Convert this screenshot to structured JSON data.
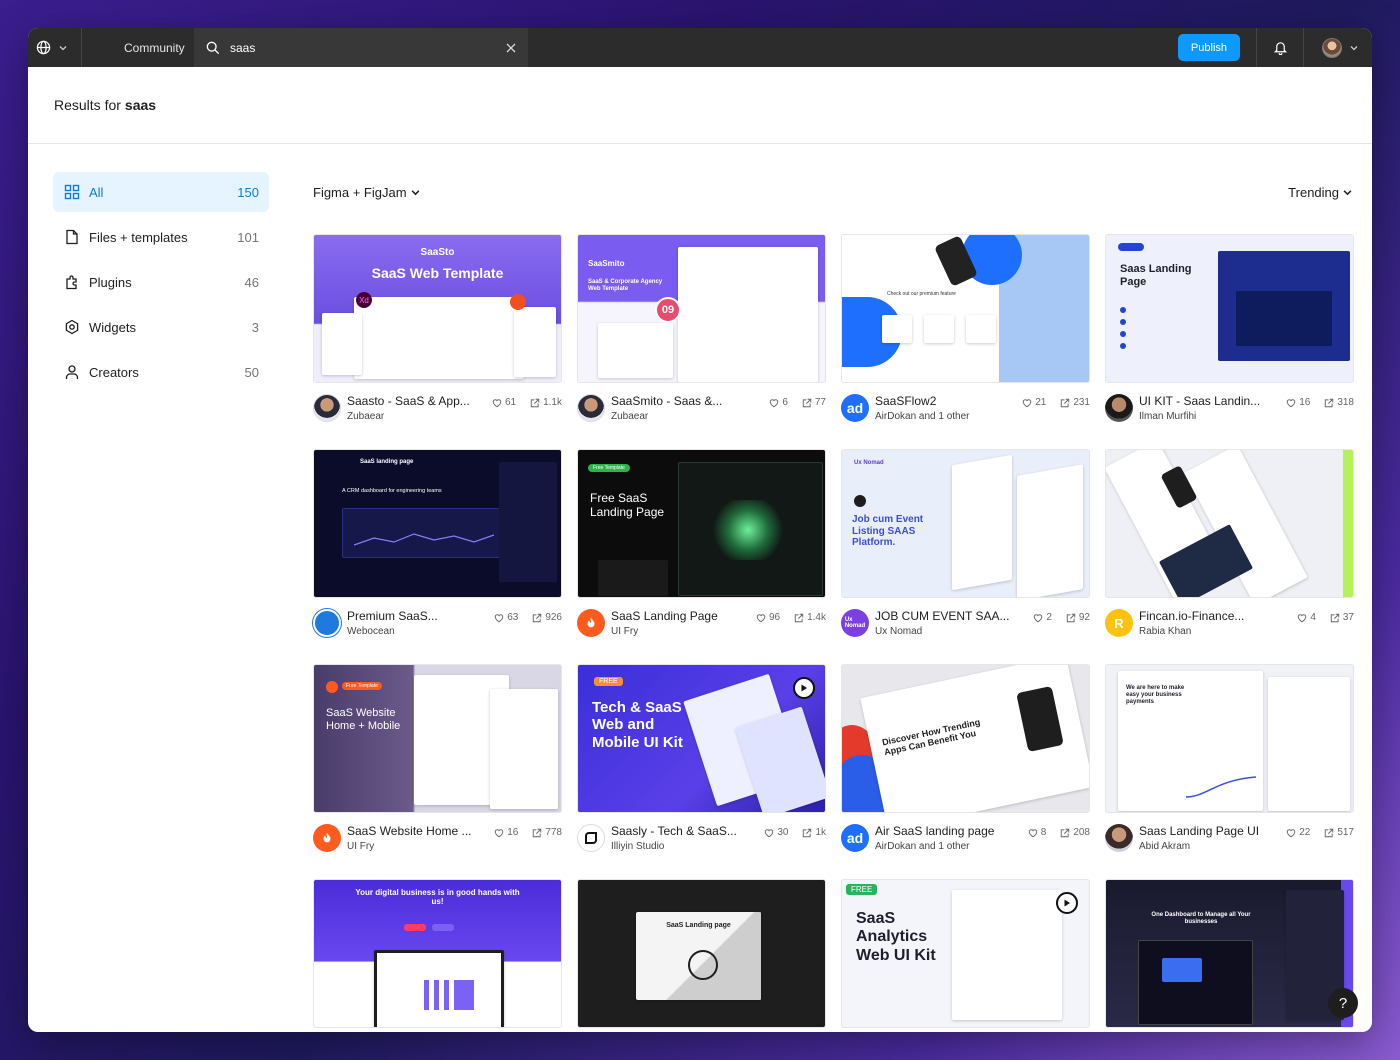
{
  "topbar": {
    "community_label": "Community",
    "search_value": "saas",
    "publish_label": "Publish"
  },
  "results": {
    "prefix": "Results for",
    "query": "saas"
  },
  "sidebar": {
    "items": [
      {
        "label": "All",
        "count": "150",
        "icon": "grid-icon"
      },
      {
        "label": "Files + templates",
        "count": "101",
        "icon": "file-icon"
      },
      {
        "label": "Plugins",
        "count": "46",
        "icon": "plugin-icon"
      },
      {
        "label": "Widgets",
        "count": "3",
        "icon": "widget-icon"
      },
      {
        "label": "Creators",
        "count": "50",
        "icon": "person-icon"
      }
    ]
  },
  "filters": {
    "product": "Figma + FigJam",
    "sort": "Trending"
  },
  "cards": [
    {
      "title": "Saasto - SaaS & App...",
      "author": "Zubaear",
      "likes": "61",
      "uses": "1.1k",
      "thumb_title": "SaaS Web Template",
      "thumb_brand": "SaaSto"
    },
    {
      "title": "SaaSmito - Saas &...",
      "author": "Zubaear",
      "likes": "6",
      "uses": "77",
      "thumb_brand": "SaaSmito",
      "thumb_title": "SaaS & Corporate Agency Web Template",
      "thumb_badge": "09"
    },
    {
      "title": "SaaSFlow2",
      "author": "AirDokan and 1 other",
      "likes": "21",
      "uses": "231",
      "thumb_title": "Check out our premium feature"
    },
    {
      "title": "UI KIT - Saas Landin...",
      "author": "Ilman Murfihi",
      "likes": "16",
      "uses": "318",
      "thumb_title": "Saas Landing Page"
    },
    {
      "title": "Premium SaaS...",
      "author": "Webocean",
      "likes": "63",
      "uses": "926",
      "thumb_title": "SaaS landing page",
      "thumb_sub": "A CRM dashboard for engineering teams"
    },
    {
      "title": "SaaS Landing Page",
      "author": "UI Fry",
      "likes": "96",
      "uses": "1.4k",
      "thumb_title": "Free SaaS Landing Page",
      "thumb_tag": "Free Template"
    },
    {
      "title": "JOB CUM EVENT SAA...",
      "author": "Ux Nomad",
      "likes": "2",
      "uses": "92",
      "thumb_title": "Job cum Event Listing SAAS Platform.",
      "thumb_brand": "Ux Nomad"
    },
    {
      "title": "Fincan.io-Finance...",
      "author": "Rabia Khan",
      "likes": "4",
      "uses": "37"
    },
    {
      "title": "SaaS Website Home ...",
      "author": "UI Fry",
      "likes": "16",
      "uses": "778",
      "thumb_title": "SaaS Website Home + Mobile",
      "thumb_tag": "Free Template"
    },
    {
      "title": "Saasly - Tech & SaaS...",
      "author": "Illiyin Studio",
      "likes": "30",
      "uses": "1k",
      "thumb_title": "Tech & SaaS Web and Mobile UI Kit",
      "thumb_tag": "FREE"
    },
    {
      "title": "Air SaaS landing page",
      "author": "AirDokan and 1 other",
      "likes": "8",
      "uses": "208",
      "thumb_title": "Discover How Trending Apps Can Benefit You"
    },
    {
      "title": "Saas Landing Page UI",
      "author": "Abid Akram",
      "likes": "22",
      "uses": "517",
      "thumb_title": "We are here to make easy your business payments"
    },
    {
      "title": "",
      "author": "",
      "likes": "",
      "uses": "",
      "thumb_title": "Your digital business is in good hands with us!"
    },
    {
      "title": "",
      "author": "",
      "likes": "",
      "uses": "",
      "thumb_title": "SaaS Landing page"
    },
    {
      "title": "",
      "author": "",
      "likes": "",
      "uses": "",
      "thumb_title": "SaaS Analytics Web UI Kit",
      "thumb_tag": "FREE"
    },
    {
      "title": "",
      "author": "",
      "likes": "",
      "uses": "",
      "thumb_title": "One Dashboard to Manage all Your businesses"
    }
  ],
  "colors": {
    "accent": "#0d99ff",
    "active_bg": "#e5f4ff",
    "topbar": "#2c2c2c"
  },
  "help_label": "?"
}
